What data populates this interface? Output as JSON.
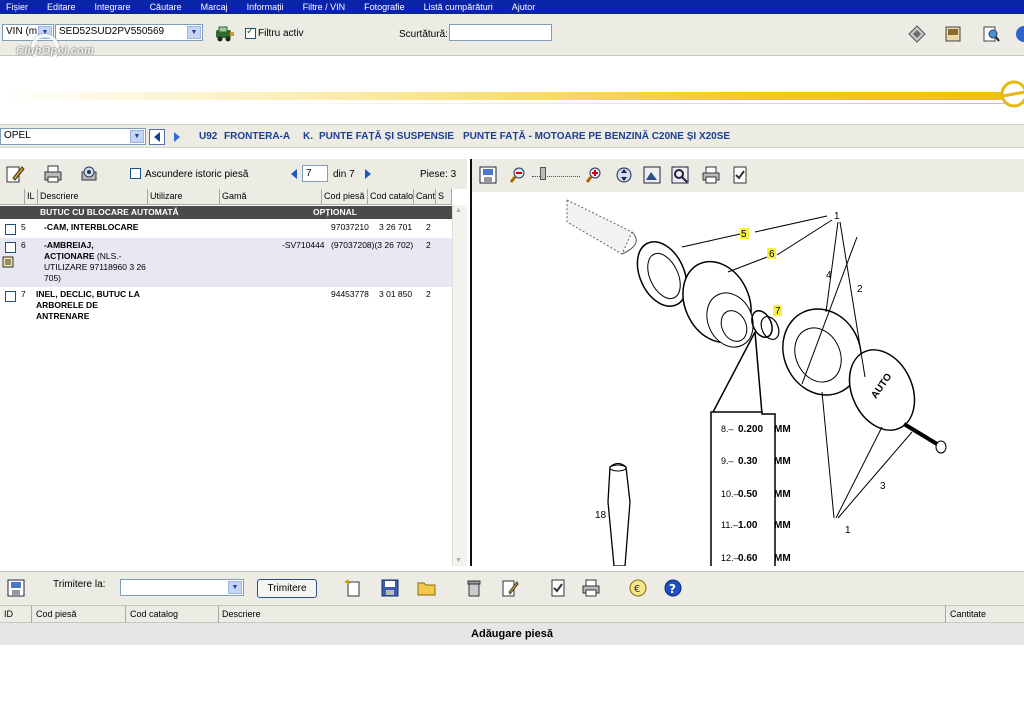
{
  "menu": [
    "Fișier",
    "Editare",
    "Integrare",
    "Căutare",
    "Marcaj",
    "Informații",
    "Filtre / VIN",
    "Fotografie",
    "Listă cumpărături",
    "Ajutor"
  ],
  "vin_bar": {
    "mode_select": "VIN (m",
    "vin_value": "SED52SUD2PV550569",
    "active_filter_label": "Filtru activ",
    "shortcut_label": "Scurtătură:",
    "shortcut_value": ""
  },
  "watermark": "ClubOpel.com",
  "breadcrumb": {
    "make_select": "OPEL",
    "items": [
      "U92",
      "FRONTERA-A",
      "K.",
      "PUNTE FAȚĂ ȘI SUSPENSIE",
      "PUNTE FAȚĂ - MOTOARE PE BENZINĂ C20NE ȘI X20SE"
    ]
  },
  "parts_list": {
    "hide_history_label": "Ascundere istoric piesă",
    "page_current": "7",
    "page_total_label": "din 7",
    "parts_count_label": "Piese: 3",
    "columns": [
      "IL",
      "Descriere",
      "Utilizare",
      "Gamă",
      "Cod piesă",
      "Cod catalog",
      "Cant.",
      "S"
    ],
    "group_header": "BUTUC CU BLOCARE AUTOMATĂ",
    "group_option": "OPȚIONAL",
    "rows": [
      {
        "il": "5",
        "desc": "-CAM, INTERBLOCARE",
        "code": "97037210",
        "catalog": "3 26 701",
        "qty": "2"
      },
      {
        "il": "6",
        "desc": "-AMBREIAJ,",
        "desc2": "ACȚIONARE",
        "desc3": "(NLS.-",
        "desc4": "UTILIZARE 97118960 3 26",
        "desc5": "705)",
        "code": "-SV710444",
        "catalog": "(97037208)(3 26 702)",
        "qty": "2"
      },
      {
        "il": "7",
        "desc": "INEL, DECLIC, BUTUC LA",
        "desc2": "ARBORELE DE",
        "desc3": "ANTRENARE",
        "code": "94453778",
        "catalog": "3 01 850",
        "qty": "2"
      }
    ]
  },
  "diagram": {
    "labels": [
      "1",
      "2",
      "3",
      "4",
      "5",
      "6",
      "7",
      "18"
    ],
    "shim_table": [
      {
        "n": "8.–",
        "v": "0.200",
        "u": "MM"
      },
      {
        "n": "9.–",
        "v": "0.30",
        "u": "MM"
      },
      {
        "n": "10.–",
        "v": "0.50",
        "u": "MM"
      },
      {
        "n": "11.–",
        "v": "1.00",
        "u": "MM"
      },
      {
        "n": "12.–",
        "v": "0.60",
        "u": "MM"
      }
    ],
    "hub_text": "AUTO"
  },
  "cart": {
    "send_to_label": "Trimitere la:",
    "send_to_value": "",
    "send_button": "Trimitere",
    "columns": [
      "ID",
      "Cod piesă",
      "Cod catalog",
      "Descriere",
      "Cantitate"
    ],
    "add_part_label": "Adăugare piesă"
  },
  "colors": {
    "menu_bg": "#0a24a8",
    "toolbar_bg": "#ecece4",
    "breadcrumb_text": "#1c3f92",
    "highlight_label": "#f7f140"
  }
}
